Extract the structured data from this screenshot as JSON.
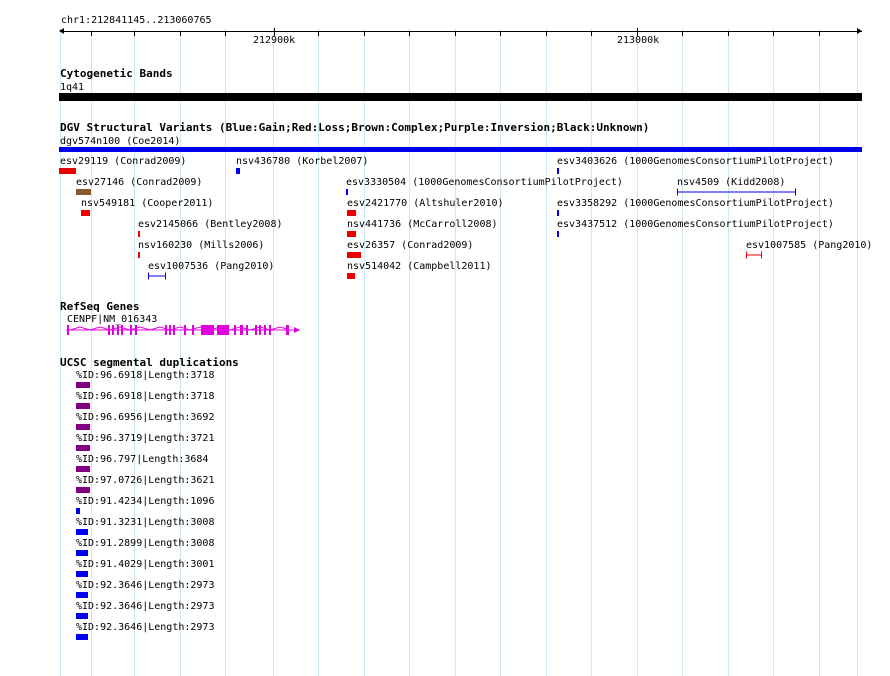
{
  "ruler": {
    "location": "chr1:212841145..213060765",
    "major_ticks": [
      "212900k",
      "213000k"
    ]
  },
  "cytoband": {
    "title": "Cytogenetic Bands",
    "band": "1q41",
    "color": "#000000"
  },
  "dgv": {
    "title": "DGV Structural Variants (Blue:Gain;Red:Loss;Brown:Complex;Purple:Inversion;Black:Unknown)",
    "summary_label": "dgv574n100 (Coe2014)",
    "summary_color": "#0000ee",
    "features": [
      {
        "label": "esv29119 (Conrad2009)",
        "color": "#ee0000"
      },
      {
        "label": "nsv436780 (Korbel2007)",
        "color": "#0000ee"
      },
      {
        "label": "esv3403626 (1000GenomesConsortiumPilotProject)",
        "color": "#0000ee"
      },
      {
        "label": "esv27146 (Conrad2009)",
        "color": "#8b5a2b"
      },
      {
        "label": "esv3330504 (1000GenomesConsortiumPilotProject)",
        "color": "#0000ee"
      },
      {
        "label": "nsv4509 (Kidd2008)",
        "color": "#0000ee"
      },
      {
        "label": "nsv549181 (Cooper2011)",
        "color": "#ee0000"
      },
      {
        "label": "esv2421770 (Altshuler2010)",
        "color": "#ee0000"
      },
      {
        "label": "esv3358292 (1000GenomesConsortiumPilotProject)",
        "color": "#0000ee"
      },
      {
        "label": "esv2145066 (Bentley2008)",
        "color": "#ee0000"
      },
      {
        "label": "nsv441736 (McCarroll2008)",
        "color": "#ee0000"
      },
      {
        "label": "esv3437512 (1000GenomesConsortiumPilotProject)",
        "color": "#0000ee"
      },
      {
        "label": "nsv160230 (Mills2006)",
        "color": "#ee0000"
      },
      {
        "label": "esv26357 (Conrad2009)",
        "color": "#ee0000"
      },
      {
        "label": "esv1007585 (Pang2010)",
        "color": "#ee0000"
      },
      {
        "label": "esv1007536 (Pang2010)",
        "color": "#0000ee"
      },
      {
        "label": "nsv514042 (Campbell2011)",
        "color": "#ee0000"
      }
    ]
  },
  "refseq": {
    "title": "RefSeq Genes",
    "gene_label": "CENPF|NM_016343",
    "color": "#e000e0"
  },
  "segdups": {
    "title": "UCSC segmental duplications",
    "items": [
      {
        "label": "%ID:96.6918|Length:3718",
        "color": "#800080"
      },
      {
        "label": "%ID:96.6918|Length:3718",
        "color": "#800080"
      },
      {
        "label": "%ID:96.6956|Length:3692",
        "color": "#800080"
      },
      {
        "label": "%ID:96.3719|Length:3721",
        "color": "#800080"
      },
      {
        "label": "%ID:96.797|Length:3684",
        "color": "#800080"
      },
      {
        "label": "%ID:97.0726|Length:3621",
        "color": "#800080"
      },
      {
        "label": "%ID:91.4234|Length:1096",
        "color": "#0000ee"
      },
      {
        "label": "%ID:91.3231|Length:3008",
        "color": "#0000ee"
      },
      {
        "label": "%ID:91.2899|Length:3008",
        "color": "#0000ee"
      },
      {
        "label": "%ID:91.4029|Length:3001",
        "color": "#0000ee"
      },
      {
        "label": "%ID:92.3646|Length:2973",
        "color": "#0000ee"
      },
      {
        "label": "%ID:92.3646|Length:2973",
        "color": "#0000ee"
      },
      {
        "label": "%ID:92.3646|Length:2973",
        "color": "#0000ee"
      }
    ]
  }
}
